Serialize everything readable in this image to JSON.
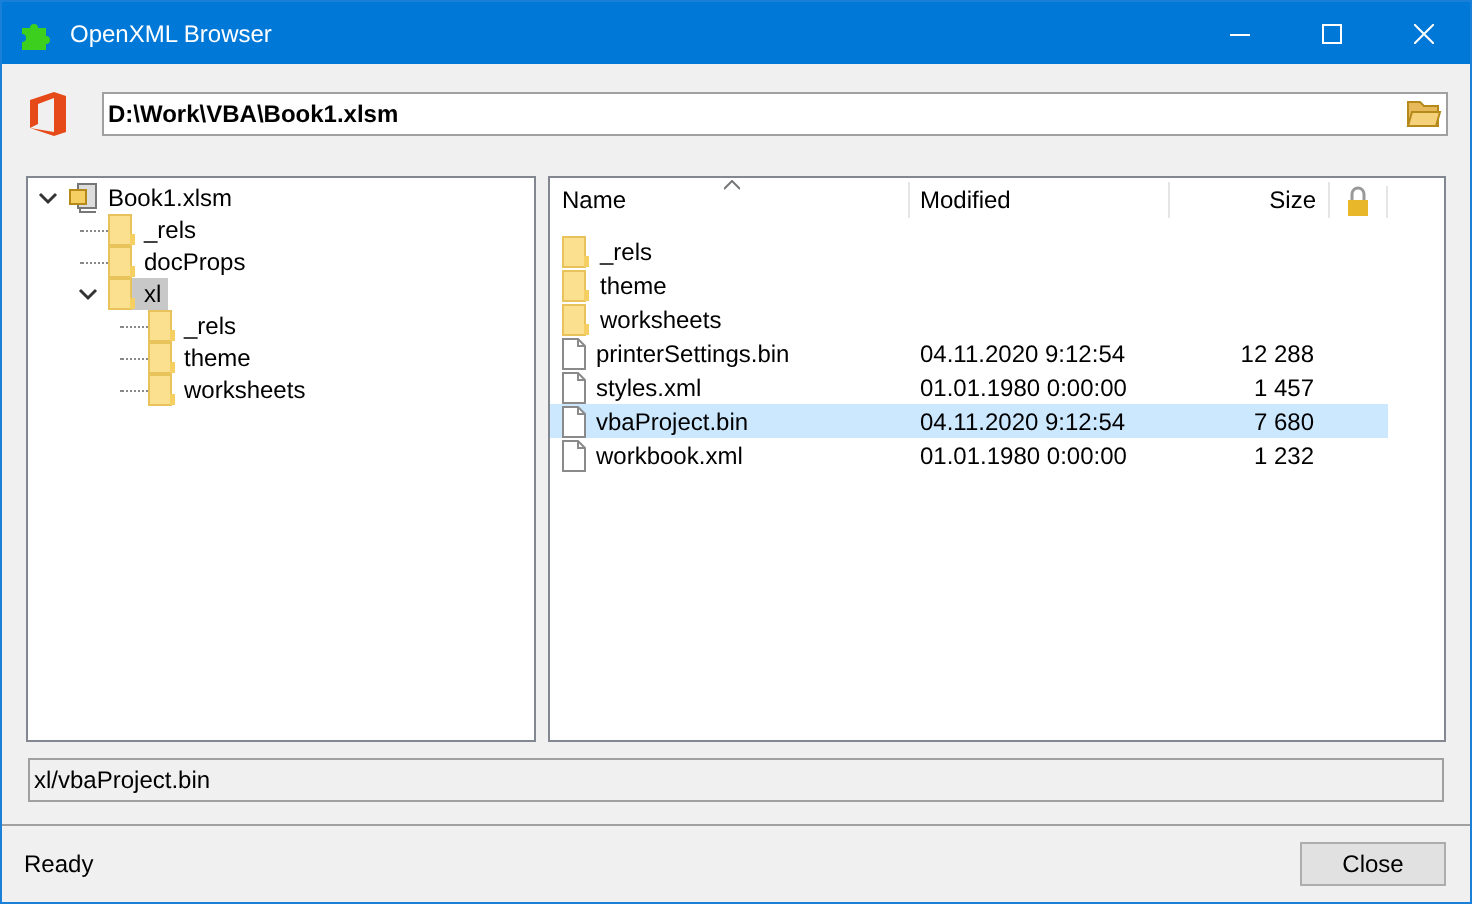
{
  "window": {
    "title": "OpenXML Browser"
  },
  "path_field": {
    "value": "D:\\Work\\VBA\\Book1.xlsm"
  },
  "tree": [
    {
      "label": "Book1.xlsm",
      "kind": "file",
      "expanded": true,
      "selected": false,
      "children": [
        {
          "label": "_rels",
          "kind": "folder",
          "selected": false
        },
        {
          "label": "docProps",
          "kind": "folder",
          "selected": false
        },
        {
          "label": "xl",
          "kind": "folder",
          "expanded": true,
          "selected": true,
          "children": [
            {
              "label": "_rels",
              "kind": "folder",
              "selected": false
            },
            {
              "label": "theme",
              "kind": "folder",
              "selected": false
            },
            {
              "label": "worksheets",
              "kind": "folder",
              "selected": false
            }
          ]
        }
      ]
    }
  ],
  "table": {
    "columns": [
      "Name",
      "Modified",
      "Size"
    ],
    "rows": [
      {
        "kind": "folder",
        "name": "_rels",
        "selected": false
      },
      {
        "kind": "folder",
        "name": "theme",
        "selected": false
      },
      {
        "kind": "folder",
        "name": "worksheets",
        "selected": false
      },
      {
        "kind": "file",
        "name": "printerSettings.bin",
        "modified": "04.11.2020 9:12:54",
        "size": "12 288",
        "selected": false
      },
      {
        "kind": "file",
        "name": "styles.xml",
        "modified": "01.01.1980 0:00:00",
        "size": "1 457",
        "selected": false
      },
      {
        "kind": "file",
        "name": "vbaProject.bin",
        "modified": "04.11.2020 9:12:54",
        "size": "7 680",
        "selected": true
      },
      {
        "kind": "file",
        "name": "workbook.xml",
        "modified": "01.01.1980 0:00:00",
        "size": "1 232",
        "selected": false
      }
    ]
  },
  "selected_path": "xl/vbaProject.bin",
  "status": "Ready",
  "buttons": [
    "Close"
  ]
}
